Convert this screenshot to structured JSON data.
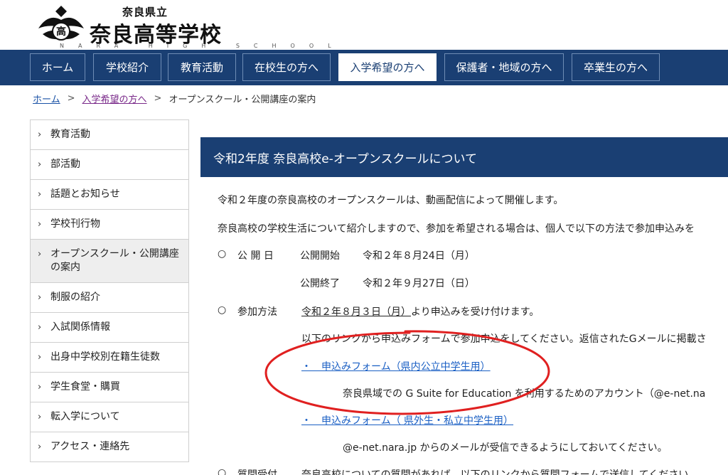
{
  "header": {
    "prefecture": "奈良県立",
    "school_name": "奈良高等学校",
    "school_roman": "NARA HIGH SCHOOL",
    "emblem_char": "高"
  },
  "nav": {
    "items": [
      {
        "label": "ホーム"
      },
      {
        "label": "学校紹介"
      },
      {
        "label": "教育活動"
      },
      {
        "label": "在校生の方へ"
      },
      {
        "label": "入学希望の方へ",
        "active": true
      },
      {
        "label": "保護者・地域の方へ"
      },
      {
        "label": "卒業生の方へ"
      }
    ]
  },
  "breadcrumb": {
    "home": "ホーム",
    "parent": "入学希望の方へ",
    "current": "オープンスクール・公開講座の案内",
    "separator": ">"
  },
  "sidebar": {
    "items": [
      {
        "label": "教育活動"
      },
      {
        "label": "部活動"
      },
      {
        "label": "話題とお知らせ"
      },
      {
        "label": "学校刊行物"
      },
      {
        "label": "オープンスクール・公開講座の案内",
        "active": true
      },
      {
        "label": "制服の紹介"
      },
      {
        "label": "入試関係情報"
      },
      {
        "label": "出身中学校別在籍生徒数"
      },
      {
        "label": "学生食堂・購買"
      },
      {
        "label": "転入学について"
      },
      {
        "label": "アクセス・連絡先"
      }
    ]
  },
  "article": {
    "title": "令和2年度 奈良高校e-オープンスクールについて",
    "intro1": "令和２年度の奈良高校のオープンスクールは、動画配信によって開催します。",
    "intro2": "奈良高校の学校生活について紹介しますので、参加を希望される場合は、個人で以下の方法で参加申込みを",
    "bullet": "○",
    "open_label": "公 開 日",
    "open_start_label": "公開開始",
    "open_start_date": "令和２年８月24日（月）",
    "open_end_label": "公開終了",
    "open_end_date": "令和２年９月27日（日）",
    "apply_label": "参加方法",
    "apply_date": "令和２年８月３日（月）",
    "apply_suffix": "より申込みを受け付けます。",
    "apply_desc": "以下のリンクから申込みフォームで参加申込をしてください。返信されたGメールに掲載さ",
    "link_marker": "・",
    "form1": "申込みフォーム（県内公立中学生用）",
    "form1_note": "奈良県域での G Suite for Education を利用するためのアカウント（@e-net.na",
    "form2": "申込みフォーム（ 県外生・私立中学生用）",
    "form2_note": "@e-net.nara.jp からのメールが受信できるようにしておいてください。",
    "question_label": "質問受付",
    "question_text": "奈良高校についての質問があれば、以下のリンクから質問フォームで送信してください"
  },
  "colors": {
    "nav_bg": "#1a3f73",
    "link": "#1a5fc4",
    "annotation": "#e02020"
  }
}
